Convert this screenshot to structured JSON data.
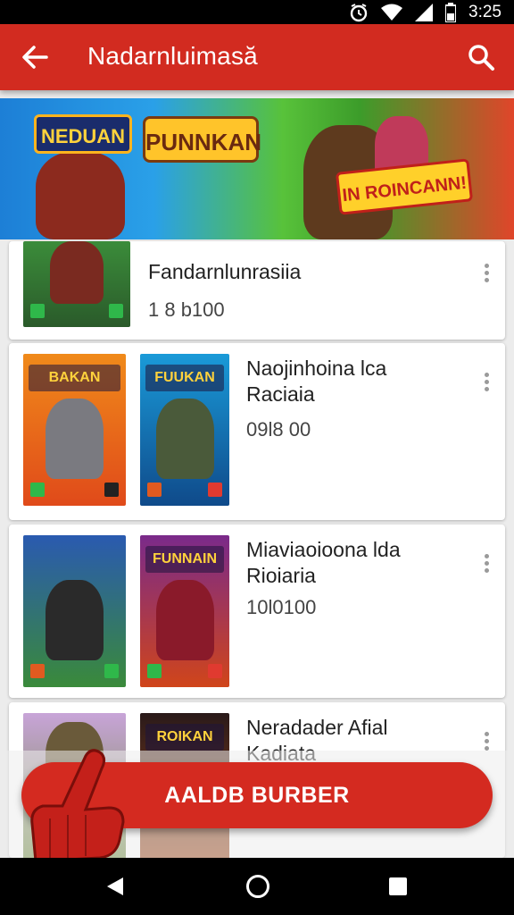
{
  "status_bar": {
    "time": "3:25",
    "icons": [
      "alarm-icon",
      "wifi-icon",
      "signal-icon",
      "battery-icon"
    ]
  },
  "app_bar": {
    "title": "Nadarnluimasă",
    "back_icon": "arrow-left-icon",
    "search_icon": "search-icon",
    "color": "#d22b20"
  },
  "banner": {
    "title_1": "NEDUAN",
    "title_2": "PUNNKAN",
    "cta": "IN ROINCANN!"
  },
  "cards": [
    {
      "title": "Fandarnlunrasiia",
      "price": "1 8 b100",
      "thumbs": [
        ""
      ]
    },
    {
      "title": "Naojinhoina lca Raciaia",
      "price": "09l8 00",
      "thumbs": [
        "BAKAN",
        "FUUKAN"
      ]
    },
    {
      "title": "Miaviaoioona lda Rioiaria",
      "price": "10l0100",
      "thumbs": [
        "",
        "FUNNAIN"
      ]
    },
    {
      "title": "Neradader Afial Kadiata",
      "price": "",
      "thumbs": [
        "",
        "ROIKAN"
      ]
    }
  ],
  "fab": {
    "label": "AALDB BURBER",
    "color": "#d42a20"
  },
  "nav_bar": {
    "icons": [
      "back-triangle-icon",
      "home-circle-icon",
      "recent-square-icon"
    ]
  }
}
